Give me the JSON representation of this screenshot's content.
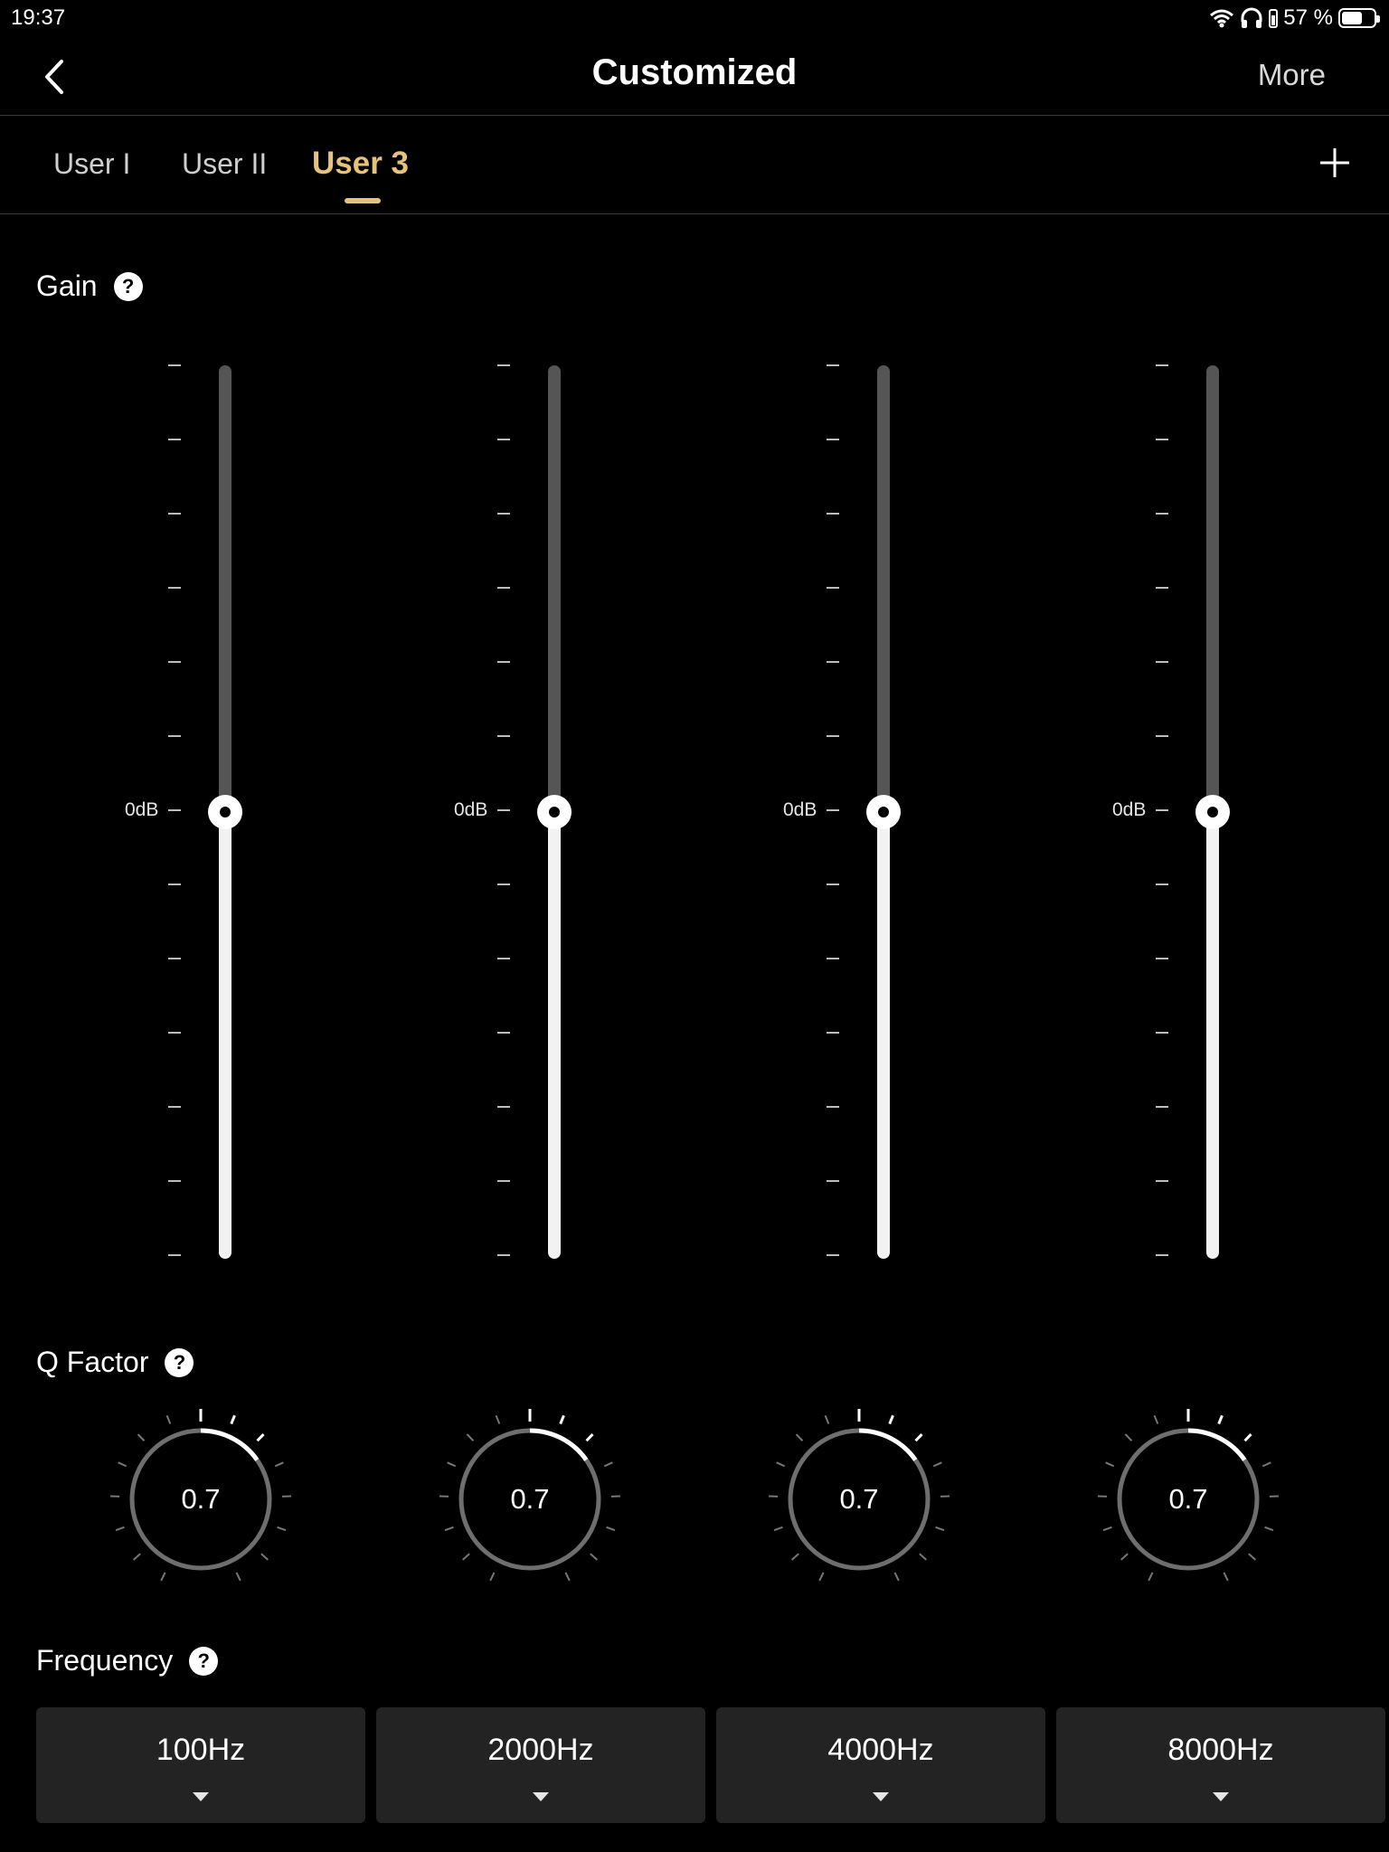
{
  "status_bar": {
    "time": "19:37",
    "battery_text": "57 %"
  },
  "nav": {
    "title": "Customized",
    "more_label": "More"
  },
  "tabs": [
    {
      "label": "User I",
      "active": false
    },
    {
      "label": "User II",
      "active": false
    },
    {
      "label": "User 3",
      "active": true
    }
  ],
  "gain": {
    "label": "Gain",
    "help": "?",
    "zero_label": "0dB",
    "bands": [
      {
        "level": 0.5
      },
      {
        "level": 0.5
      },
      {
        "level": 0.5
      },
      {
        "level": 0.5
      }
    ]
  },
  "q_factor": {
    "label": "Q Factor",
    "help": "?",
    "values": [
      "0.7",
      "0.7",
      "0.7",
      "0.7"
    ]
  },
  "frequency": {
    "label": "Frequency",
    "help": "?",
    "values": [
      "100Hz",
      "2000Hz",
      "4000Hz",
      "8000Hz"
    ]
  },
  "colors": {
    "accent": "#e6c27f",
    "background": "#000000",
    "panel": "#232323"
  }
}
